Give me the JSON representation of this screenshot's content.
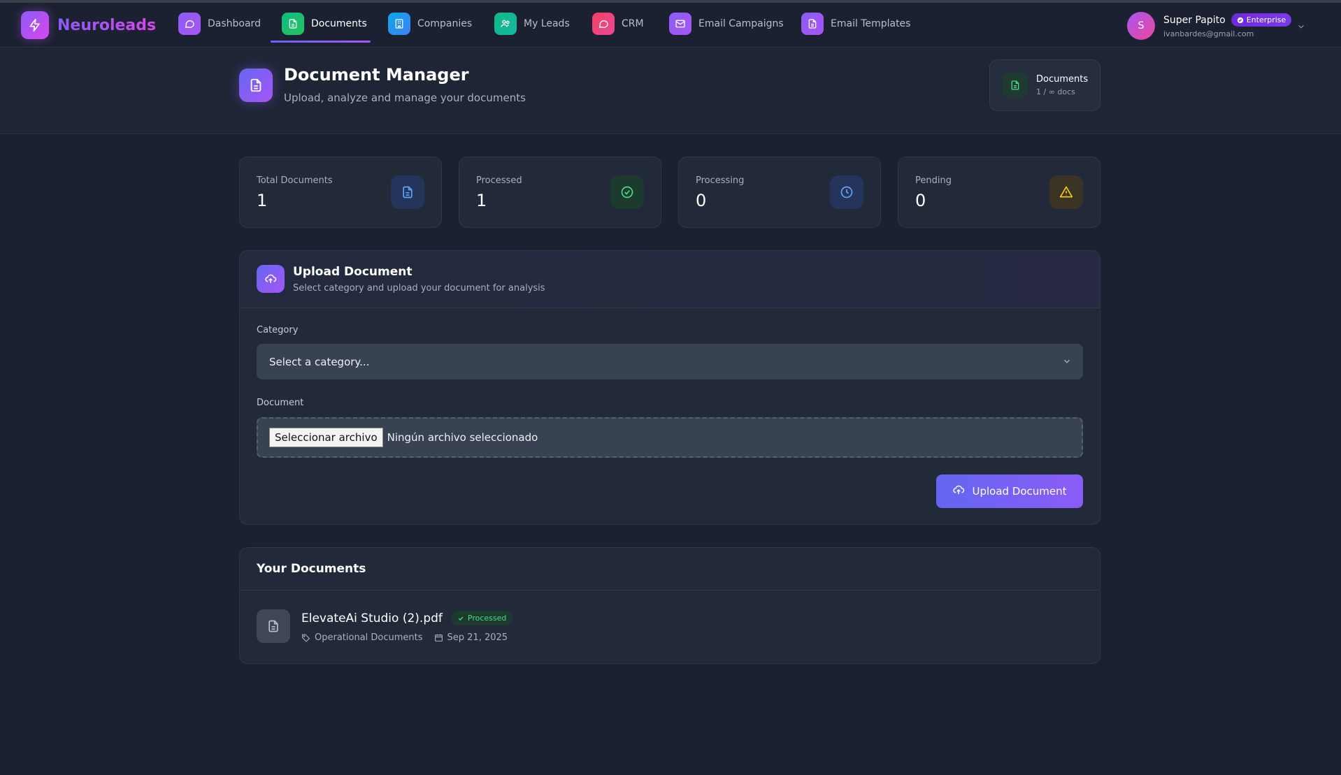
{
  "brand": {
    "name": "Neuroleads"
  },
  "nav": {
    "items": [
      {
        "label": "Dashboard"
      },
      {
        "label": "Documents"
      },
      {
        "label": "Companies"
      },
      {
        "label": "My Leads"
      },
      {
        "label": "CRM"
      },
      {
        "label": "Email Campaigns"
      },
      {
        "label": "Email Templates"
      }
    ],
    "active": "Documents"
  },
  "user": {
    "initial": "S",
    "name": "Super Papito",
    "plan": "Enterprise",
    "email": "ivanbardes@gmail.com"
  },
  "header": {
    "title": "Document Manager",
    "subtitle": "Upload, analyze and manage your documents",
    "quota_title": "Documents",
    "quota_sub": "1 / ∞ docs"
  },
  "stats": [
    {
      "label": "Total Documents",
      "value": "1",
      "color": "#60a5fa"
    },
    {
      "label": "Processed",
      "value": "1",
      "color": "#4ade80"
    },
    {
      "label": "Processing",
      "value": "0",
      "color": "#60a5fa"
    },
    {
      "label": "Pending",
      "value": "0",
      "color": "#facc15"
    }
  ],
  "upload": {
    "title": "Upload Document",
    "subtitle": "Select category and upload your document for analysis",
    "category_label": "Category",
    "category_placeholder": "Select a category...",
    "document_label": "Document",
    "file_button": "Seleccionar archivo",
    "file_status": "Ningún archivo seleccionado",
    "submit_label": "Upload Document"
  },
  "documents": {
    "title": "Your Documents",
    "items": [
      {
        "name": "ElevateAi Studio (2).pdf",
        "status": "Processed",
        "category": "Operational Documents",
        "date": "Sep 21, 2025"
      }
    ]
  }
}
